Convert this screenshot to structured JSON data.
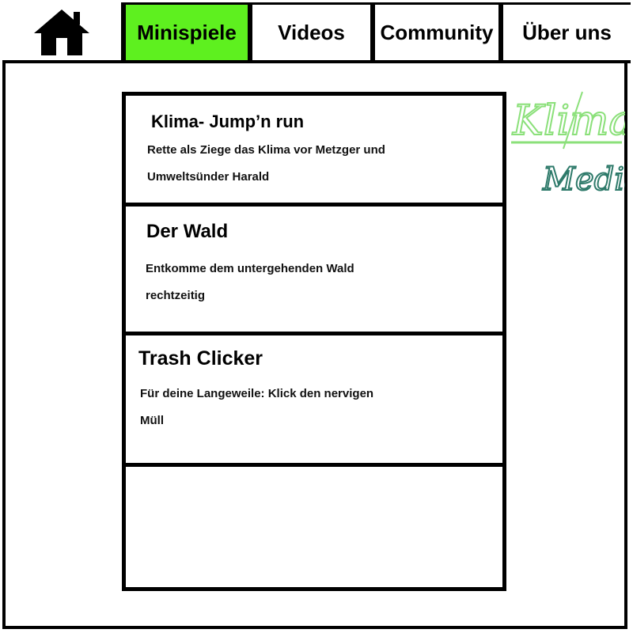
{
  "nav": {
    "home_icon": "house-icon",
    "items": [
      {
        "label": "Minispiele",
        "active": true
      },
      {
        "label": "Videos",
        "active": false
      },
      {
        "label": "Community",
        "active": false
      },
      {
        "label": "Über uns",
        "active": false
      }
    ],
    "active_color": "#5ef01f"
  },
  "games": [
    {
      "title": "Klima- Jump’n run",
      "description": "Rette als Ziege das Klima vor Metzger und Umweltsünder Harald"
    },
    {
      "title": "Der Wald",
      "description": "Entkomme dem untergehenden Wald rechtzeitig"
    },
    {
      "title": "Trash Clicker",
      "description": "Für deine Langeweile: Klick den nervigen Müll"
    },
    {
      "title": "",
      "description": ""
    }
  ],
  "logo": {
    "text_top": "Klima",
    "text_bottom": "Media",
    "color_top": "#8be07a",
    "color_bottom": "#2e7a6a"
  }
}
